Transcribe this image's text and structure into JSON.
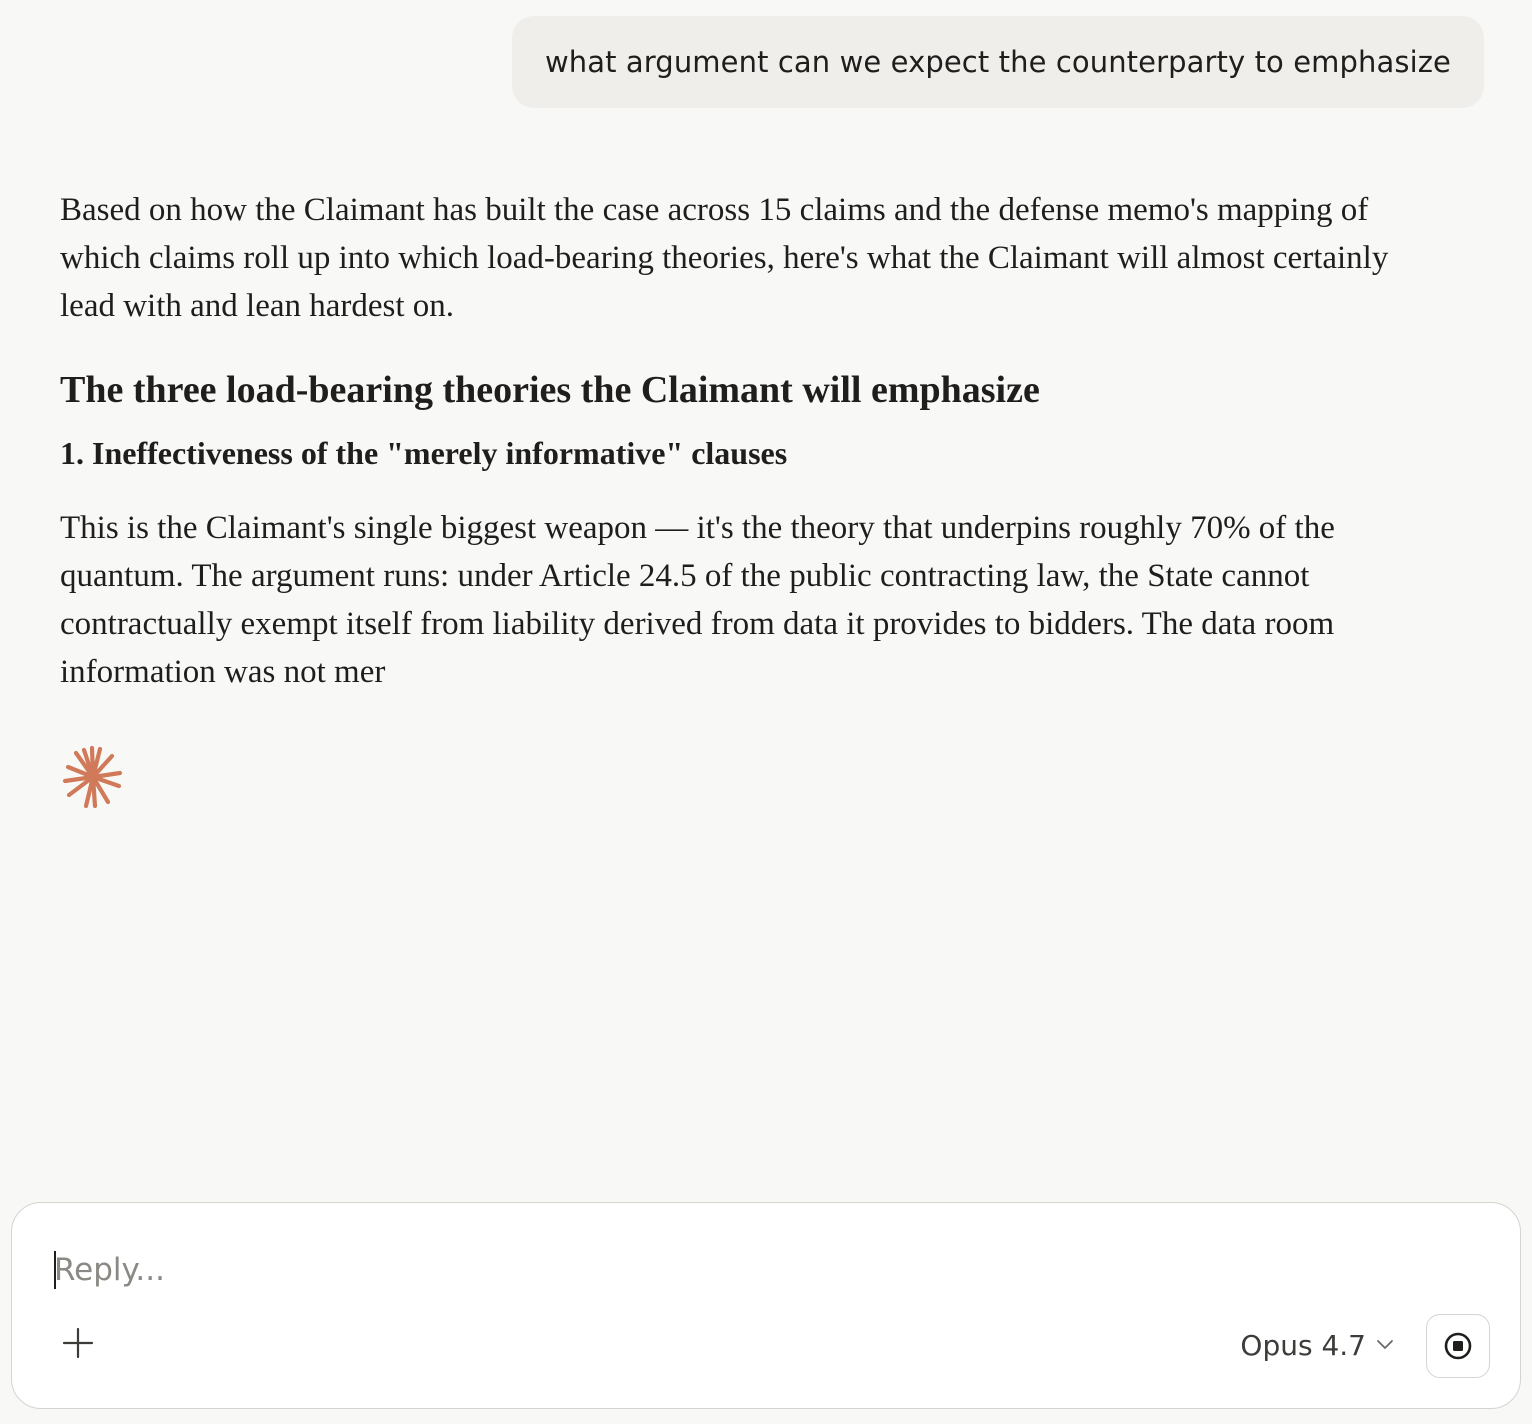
{
  "user_message": {
    "text": "what argument can we expect the counterparty to emphasize"
  },
  "response": {
    "intro": "Based on how the Claimant has built the case across 15 claims and the defense memo's mapping of which claims roll up into which load-bearing theories, here's what the Claimant will almost certainly lead with and lean hardest on.",
    "heading": "The three load-bearing theories the Claimant will emphasize",
    "subheading": "1. Ineffectiveness of the \"merely informative\" clauses",
    "body": "This is the Claimant's single biggest weapon — it's the theory that underpins roughly 70% of the quantum. The argument runs: under Article 24.5 of the public contracting law, the State cannot contractually exempt itself from liability derived from data it provides to bidders. The data room information was not mer"
  },
  "status": {
    "icon": "sparkle-spinner-icon",
    "color": "#d07a5a"
  },
  "composer": {
    "placeholder": "Reply...",
    "value": "",
    "model_label": "Opus 4.7",
    "add_icon": "plus-icon",
    "model_icon": "chevron-down-icon",
    "stop_icon": "stop-icon"
  }
}
